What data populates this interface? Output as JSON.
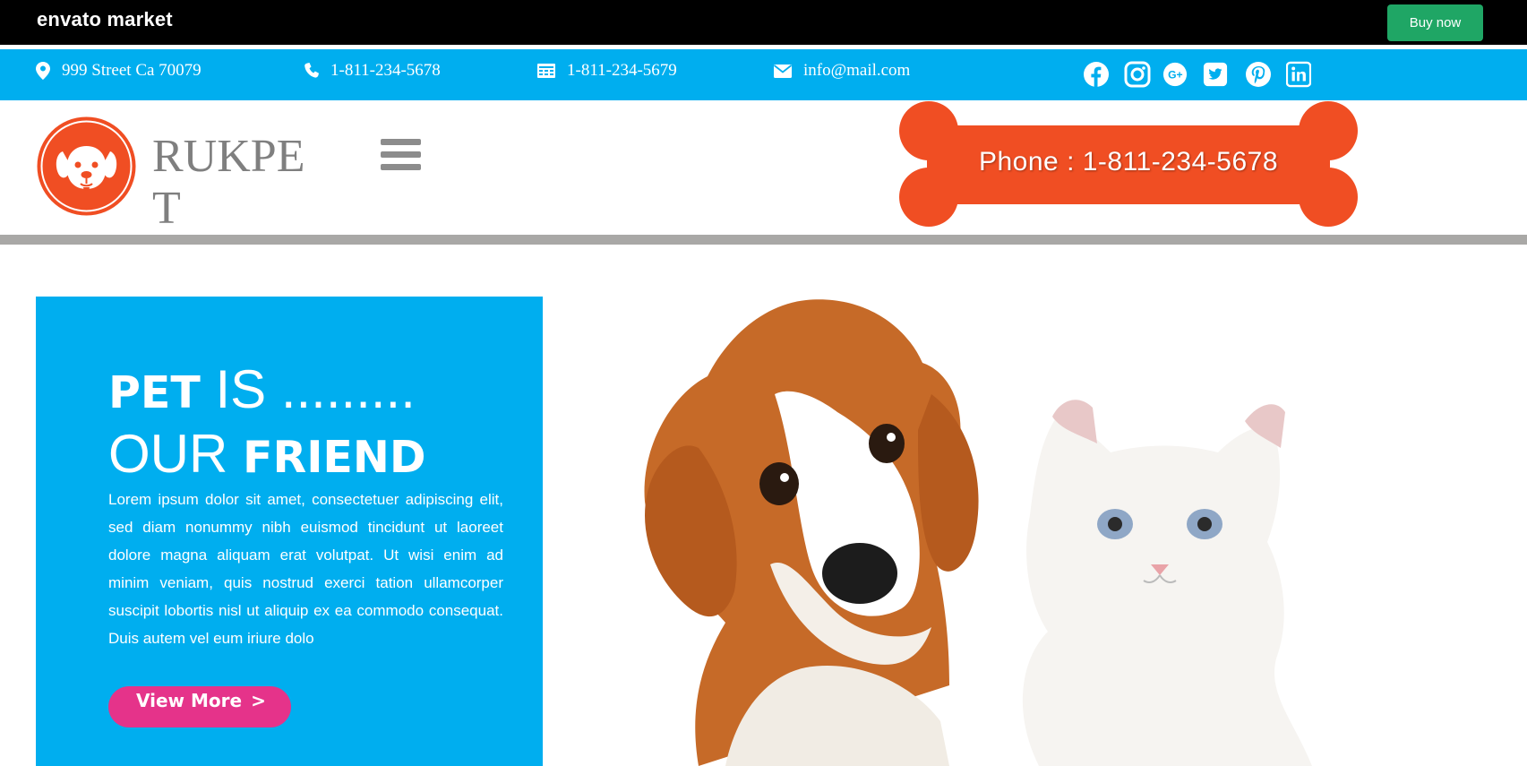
{
  "envato_bar": {
    "logo": "envato market",
    "buy_label": "Buy now"
  },
  "info_bar": {
    "address": "999  Street Ca 70079",
    "phone": "1-811-234-5678",
    "fax": "1-811-234-5679",
    "email": "info@mail.com",
    "icons": [
      "map-pin-icon",
      "phone-icon",
      "fax-icon",
      "envelope-icon"
    ],
    "social": [
      "facebook-icon",
      "instagram-icon",
      "google-plus-icon",
      "twitter-icon",
      "pinterest-icon",
      "linkedin-icon"
    ]
  },
  "header": {
    "brand": "RUKPET",
    "phone_banner": "Phone : 1-811-234-5678"
  },
  "hero": {
    "title_bold_1": "PET",
    "title_light_1": " IS .........",
    "title_light_2": "OUR ",
    "title_bold_2": "FRIEND",
    "body": "Lorem ipsum dolor sit amet, consectetuer adipiscing elit, sed diam nonummy nibh euismod tincidunt ut laoreet dolore magna aliquam erat volutpat. Ut wisi enim ad minim veniam, quis nostrud exerci tation ullamcorper suscipit lobortis nisl ut aliquip ex ea commodo consequat. Duis autem vel eum iriure dolo",
    "button_label": "View More",
    "button_chevron": ">"
  },
  "colors": {
    "info_blue": "#00aeef",
    "buy_green": "#1fa665",
    "bone_orange": "#f04e23",
    "button_pink": "#e5338a",
    "divider_gray": "#a9a8a6"
  }
}
